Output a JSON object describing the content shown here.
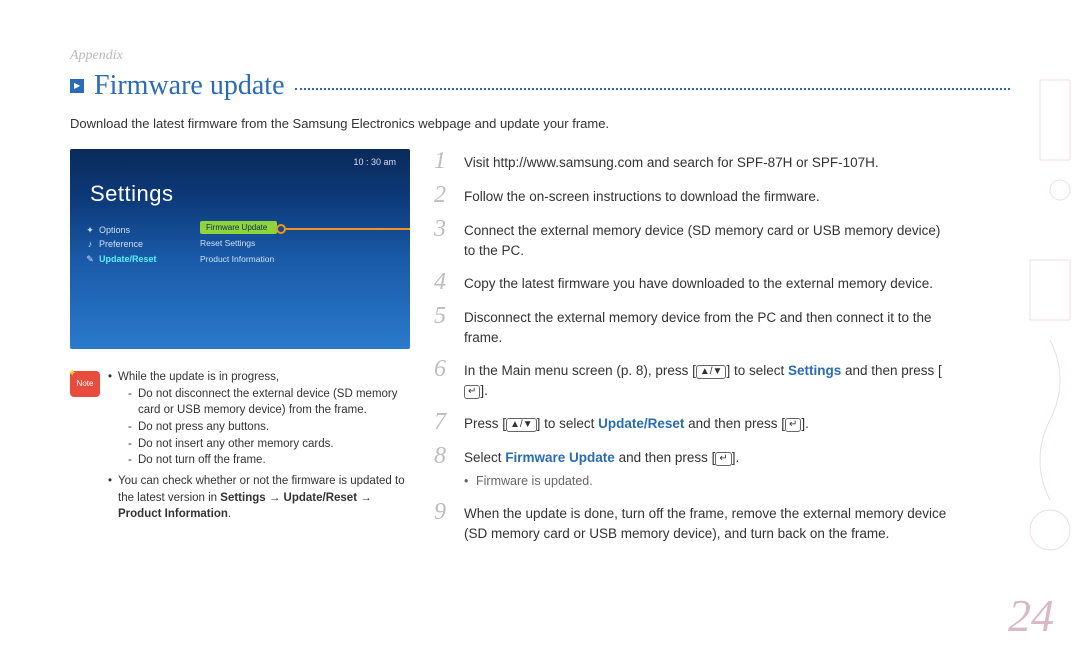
{
  "header": {
    "section": "Appendix",
    "title": "Firmware update"
  },
  "intro": "Download the latest firmware from the Samsung Electronics webpage and update your frame.",
  "screenshot": {
    "time": "10 : 30 am",
    "title": "Settings",
    "leftMenu": {
      "item1": "Options",
      "item2": "Preference",
      "item3": "Update/Reset"
    },
    "rightMenu": {
      "item1": "Firmware Update",
      "item2": "Reset Settings",
      "item3": "Product Information"
    }
  },
  "note": {
    "label": "Note",
    "bullet1": "While the update is in progress,",
    "sub1": "Do not disconnect the external device (SD memory card or USB memory device) from the frame.",
    "sub2": "Do not press any buttons.",
    "sub3": "Do not insert any other memory cards.",
    "sub4": "Do not turn off the frame.",
    "bullet2_a": "You can check whether or not the firmware is updated to the latest version in ",
    "bullet2_b": "Settings → Update/Reset → Product Information",
    "bullet2_c": "."
  },
  "steps": {
    "s1": "Visit http://www.samsung.com and search for SPF-87H or SPF-107H.",
    "s2": "Follow the on-screen instructions to download the firmware.",
    "s3": "Connect the external memory device (SD memory card or USB memory device) to the PC.",
    "s4": "Copy the latest firmware you have downloaded to the external memory device.",
    "s5": "Disconnect the external memory device from the PC and then connect it to the frame.",
    "s6_a": "In the Main menu screen (p. 8), press [",
    "s6_key1": "▲/▼",
    "s6_b": "] to select ",
    "s6_link": "Settings",
    "s6_c": " and then press [",
    "s6_key2": "↵",
    "s6_d": "].",
    "s7_a": "Press [",
    "s7_key1": "▲/▼",
    "s7_b": "] to select ",
    "s7_link": "Update/Reset",
    "s7_c": " and then press [",
    "s7_key2": "↵",
    "s7_d": "].",
    "s8_a": "Select ",
    "s8_link": "Firmware Update",
    "s8_b": " and then press [",
    "s8_key": "↵",
    "s8_c": "].",
    "s8_note": "Firmware is updated.",
    "s9": "When the update is done, turn off the frame, remove the external memory device (SD memory card or USB memory device), and turn back on the frame.",
    "n1": "1",
    "n2": "2",
    "n3": "3",
    "n4": "4",
    "n5": "5",
    "n6": "6",
    "n7": "7",
    "n8": "8",
    "n9": "9"
  },
  "pageNumber": "24"
}
